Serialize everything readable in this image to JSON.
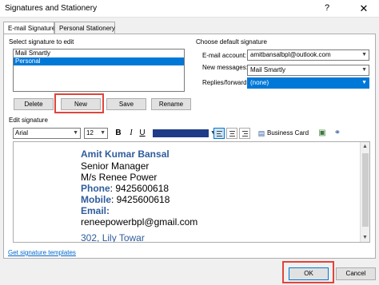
{
  "window": {
    "title": "Signatures and Stationery",
    "help": "?",
    "close": "✕"
  },
  "tabs": [
    {
      "label": "E-mail Signature"
    },
    {
      "label": "Personal Stationery"
    }
  ],
  "select_signature": {
    "label": "Select signature to edit",
    "items": [
      "Mail Smartly",
      "Personal"
    ],
    "selected": "Personal"
  },
  "buttons": {
    "delete": "Delete",
    "new": "New",
    "save": "Save",
    "rename": "Rename",
    "business_card": "Business Card",
    "ok": "OK",
    "cancel": "Cancel"
  },
  "defaults": {
    "label": "Choose default signature",
    "email_account_label": "E-mail account:",
    "email_account_value": "amitbansalbpl@outlook.com",
    "new_messages_label": "New messages:",
    "new_messages_value": "Mail Smartly",
    "replies_label": "Replies/forwards:",
    "replies_value": "(none)"
  },
  "edit": {
    "label": "Edit signature",
    "font": "Arial",
    "size": "12",
    "bold": "B",
    "italic": "I",
    "underline": "U"
  },
  "signature_content": {
    "name": "Amit Kumar Bansal",
    "title": "Senior Manager",
    "company": "M/s Renee Power",
    "phone_label": "Phone",
    "phone": ": 9425600618",
    "mobile_label": "Mobile",
    "mobile": ": 9425600618",
    "email_label": "Email",
    "email_colon": ":",
    "email": "reneepowerbpl@gmail.com",
    "address1": "302, Lily Towar"
  },
  "link": "Get signature templates",
  "colors": {
    "accent": "#0078d7",
    "highlight": "#e0443a",
    "signature_blue": "#2f5d9c"
  }
}
